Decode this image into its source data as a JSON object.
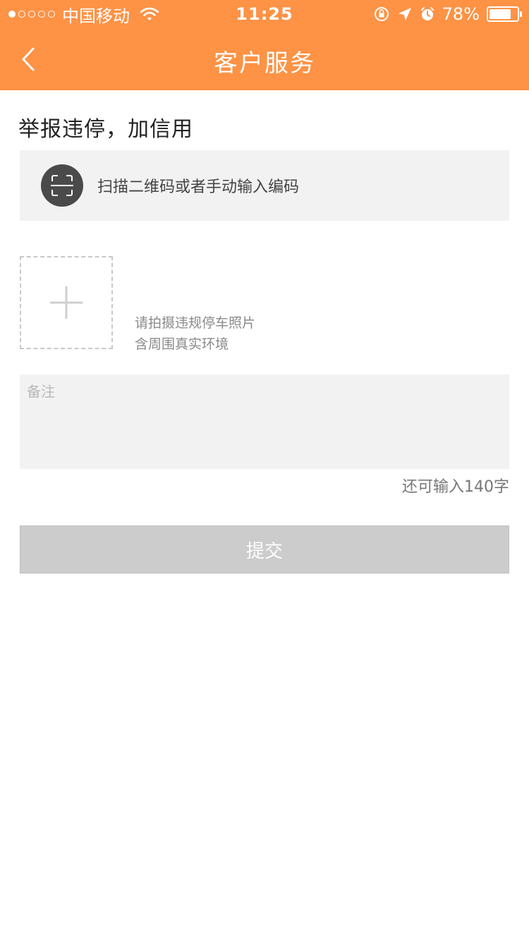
{
  "status_bar": {
    "carrier": "中国移动",
    "time": "11:25",
    "battery_text": "78%",
    "battery_level": 0.78,
    "signal_dots": 5,
    "signal_filled": 1,
    "icons": [
      "wifi-icon",
      "rotation-lock-icon",
      "location-arrow-icon",
      "alarm-icon",
      "battery-icon"
    ]
  },
  "navbar": {
    "title": "客户服务",
    "back_icon": "chevron-left-icon",
    "background": "#fe9245"
  },
  "main": {
    "heading": "举报违停，加信用",
    "scan": {
      "label": "扫描二维码或者手动输入编码",
      "icon": "scan-qr-icon"
    },
    "photo": {
      "icon": "plus-icon",
      "hint_line1": "请拍摄违规停车照片",
      "hint_line2": "含周围真实环境"
    },
    "remark": {
      "placeholder": "备注",
      "value": ""
    },
    "counter": "还可输入140字",
    "submit_label": "提交"
  },
  "colors": {
    "accent": "#fe9245",
    "input_bg": "#f2f2f2",
    "submit_disabled": "#cccccc"
  }
}
